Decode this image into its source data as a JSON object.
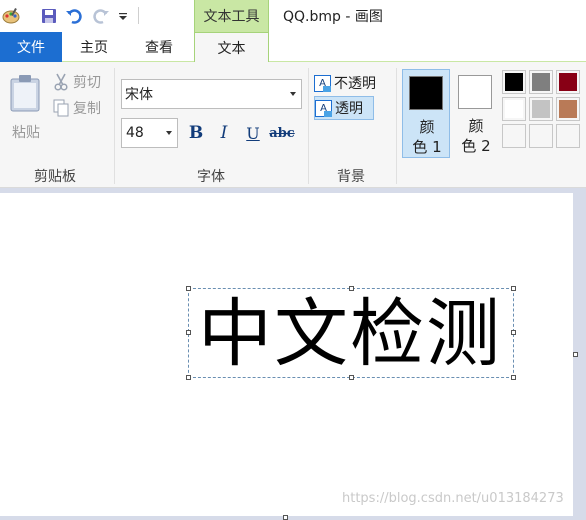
{
  "titlebar": {
    "tool_context": "文本工具",
    "window_title": "QQ.bmp - 画图"
  },
  "tabs": {
    "file": "文件",
    "home": "主页",
    "view": "查看",
    "text": "文本"
  },
  "clipboard": {
    "paste": "粘贴",
    "cut": "剪切",
    "copy": "复制",
    "group_label": "剪贴板"
  },
  "font": {
    "name": "宋体",
    "size": "48",
    "bold": "B",
    "italic": "I",
    "underline": "U",
    "strike": "abc",
    "group_label": "字体"
  },
  "background": {
    "opaque": "不透明",
    "transparent": "透明",
    "icon_letter": "A",
    "group_label": "背景",
    "selected": "transparent"
  },
  "colors": {
    "color1_label_line1": "颜",
    "color1_label_line2": "色 1",
    "color2_label_line1": "颜",
    "color2_label_line2": "色 2",
    "color1": "#000000",
    "color2": "#ffffff",
    "palette": [
      "#000000",
      "#7f7f7f",
      "#880015",
      "#ffffff",
      "#c3c3c3",
      "#b97a57",
      "#f6f6f6",
      "#f6f6f6",
      "#f6f6f6"
    ]
  },
  "canvas": {
    "text": "中文检测",
    "watermark": "https://blog.csdn.net/u013184273"
  },
  "accent": "#1c6ed1",
  "context_tab_color": "#c9e7a4"
}
